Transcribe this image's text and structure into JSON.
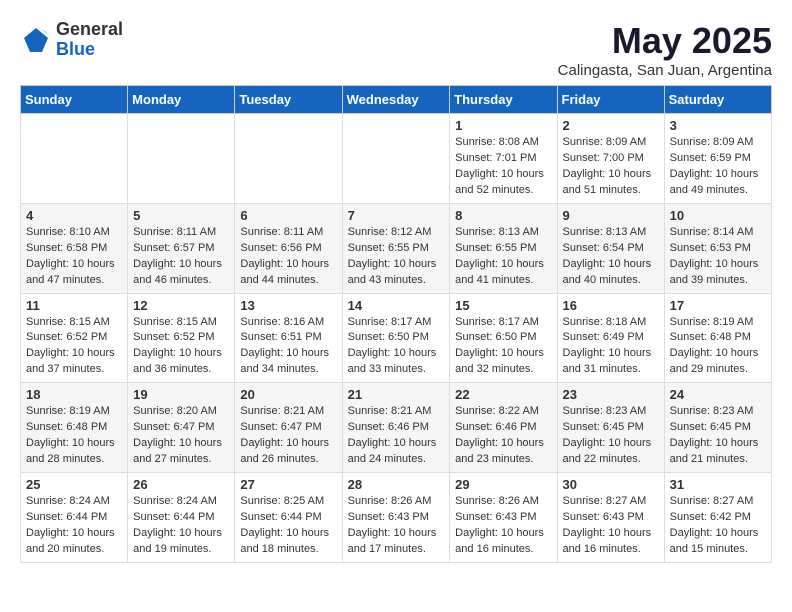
{
  "logo": {
    "general": "General",
    "blue": "Blue"
  },
  "title": "May 2025",
  "subtitle": "Calingasta, San Juan, Argentina",
  "header_days": [
    "Sunday",
    "Monday",
    "Tuesday",
    "Wednesday",
    "Thursday",
    "Friday",
    "Saturday"
  ],
  "weeks": [
    [
      {
        "day": "",
        "sunrise": "",
        "sunset": "",
        "daylight": ""
      },
      {
        "day": "",
        "sunrise": "",
        "sunset": "",
        "daylight": ""
      },
      {
        "day": "",
        "sunrise": "",
        "sunset": "",
        "daylight": ""
      },
      {
        "day": "",
        "sunrise": "",
        "sunset": "",
        "daylight": ""
      },
      {
        "day": "1",
        "sunrise": "Sunrise: 8:08 AM",
        "sunset": "Sunset: 7:01 PM",
        "daylight": "Daylight: 10 hours and 52 minutes."
      },
      {
        "day": "2",
        "sunrise": "Sunrise: 8:09 AM",
        "sunset": "Sunset: 7:00 PM",
        "daylight": "Daylight: 10 hours and 51 minutes."
      },
      {
        "day": "3",
        "sunrise": "Sunrise: 8:09 AM",
        "sunset": "Sunset: 6:59 PM",
        "daylight": "Daylight: 10 hours and 49 minutes."
      }
    ],
    [
      {
        "day": "4",
        "sunrise": "Sunrise: 8:10 AM",
        "sunset": "Sunset: 6:58 PM",
        "daylight": "Daylight: 10 hours and 47 minutes."
      },
      {
        "day": "5",
        "sunrise": "Sunrise: 8:11 AM",
        "sunset": "Sunset: 6:57 PM",
        "daylight": "Daylight: 10 hours and 46 minutes."
      },
      {
        "day": "6",
        "sunrise": "Sunrise: 8:11 AM",
        "sunset": "Sunset: 6:56 PM",
        "daylight": "Daylight: 10 hours and 44 minutes."
      },
      {
        "day": "7",
        "sunrise": "Sunrise: 8:12 AM",
        "sunset": "Sunset: 6:55 PM",
        "daylight": "Daylight: 10 hours and 43 minutes."
      },
      {
        "day": "8",
        "sunrise": "Sunrise: 8:13 AM",
        "sunset": "Sunset: 6:55 PM",
        "daylight": "Daylight: 10 hours and 41 minutes."
      },
      {
        "day": "9",
        "sunrise": "Sunrise: 8:13 AM",
        "sunset": "Sunset: 6:54 PM",
        "daylight": "Daylight: 10 hours and 40 minutes."
      },
      {
        "day": "10",
        "sunrise": "Sunrise: 8:14 AM",
        "sunset": "Sunset: 6:53 PM",
        "daylight": "Daylight: 10 hours and 39 minutes."
      }
    ],
    [
      {
        "day": "11",
        "sunrise": "Sunrise: 8:15 AM",
        "sunset": "Sunset: 6:52 PM",
        "daylight": "Daylight: 10 hours and 37 minutes."
      },
      {
        "day": "12",
        "sunrise": "Sunrise: 8:15 AM",
        "sunset": "Sunset: 6:52 PM",
        "daylight": "Daylight: 10 hours and 36 minutes."
      },
      {
        "day": "13",
        "sunrise": "Sunrise: 8:16 AM",
        "sunset": "Sunset: 6:51 PM",
        "daylight": "Daylight: 10 hours and 34 minutes."
      },
      {
        "day": "14",
        "sunrise": "Sunrise: 8:17 AM",
        "sunset": "Sunset: 6:50 PM",
        "daylight": "Daylight: 10 hours and 33 minutes."
      },
      {
        "day": "15",
        "sunrise": "Sunrise: 8:17 AM",
        "sunset": "Sunset: 6:50 PM",
        "daylight": "Daylight: 10 hours and 32 minutes."
      },
      {
        "day": "16",
        "sunrise": "Sunrise: 8:18 AM",
        "sunset": "Sunset: 6:49 PM",
        "daylight": "Daylight: 10 hours and 31 minutes."
      },
      {
        "day": "17",
        "sunrise": "Sunrise: 8:19 AM",
        "sunset": "Sunset: 6:48 PM",
        "daylight": "Daylight: 10 hours and 29 minutes."
      }
    ],
    [
      {
        "day": "18",
        "sunrise": "Sunrise: 8:19 AM",
        "sunset": "Sunset: 6:48 PM",
        "daylight": "Daylight: 10 hours and 28 minutes."
      },
      {
        "day": "19",
        "sunrise": "Sunrise: 8:20 AM",
        "sunset": "Sunset: 6:47 PM",
        "daylight": "Daylight: 10 hours and 27 minutes."
      },
      {
        "day": "20",
        "sunrise": "Sunrise: 8:21 AM",
        "sunset": "Sunset: 6:47 PM",
        "daylight": "Daylight: 10 hours and 26 minutes."
      },
      {
        "day": "21",
        "sunrise": "Sunrise: 8:21 AM",
        "sunset": "Sunset: 6:46 PM",
        "daylight": "Daylight: 10 hours and 24 minutes."
      },
      {
        "day": "22",
        "sunrise": "Sunrise: 8:22 AM",
        "sunset": "Sunset: 6:46 PM",
        "daylight": "Daylight: 10 hours and 23 minutes."
      },
      {
        "day": "23",
        "sunrise": "Sunrise: 8:23 AM",
        "sunset": "Sunset: 6:45 PM",
        "daylight": "Daylight: 10 hours and 22 minutes."
      },
      {
        "day": "24",
        "sunrise": "Sunrise: 8:23 AM",
        "sunset": "Sunset: 6:45 PM",
        "daylight": "Daylight: 10 hours and 21 minutes."
      }
    ],
    [
      {
        "day": "25",
        "sunrise": "Sunrise: 8:24 AM",
        "sunset": "Sunset: 6:44 PM",
        "daylight": "Daylight: 10 hours and 20 minutes."
      },
      {
        "day": "26",
        "sunrise": "Sunrise: 8:24 AM",
        "sunset": "Sunset: 6:44 PM",
        "daylight": "Daylight: 10 hours and 19 minutes."
      },
      {
        "day": "27",
        "sunrise": "Sunrise: 8:25 AM",
        "sunset": "Sunset: 6:44 PM",
        "daylight": "Daylight: 10 hours and 18 minutes."
      },
      {
        "day": "28",
        "sunrise": "Sunrise: 8:26 AM",
        "sunset": "Sunset: 6:43 PM",
        "daylight": "Daylight: 10 hours and 17 minutes."
      },
      {
        "day": "29",
        "sunrise": "Sunrise: 8:26 AM",
        "sunset": "Sunset: 6:43 PM",
        "daylight": "Daylight: 10 hours and 16 minutes."
      },
      {
        "day": "30",
        "sunrise": "Sunrise: 8:27 AM",
        "sunset": "Sunset: 6:43 PM",
        "daylight": "Daylight: 10 hours and 16 minutes."
      },
      {
        "day": "31",
        "sunrise": "Sunrise: 8:27 AM",
        "sunset": "Sunset: 6:42 PM",
        "daylight": "Daylight: 10 hours and 15 minutes."
      }
    ]
  ]
}
